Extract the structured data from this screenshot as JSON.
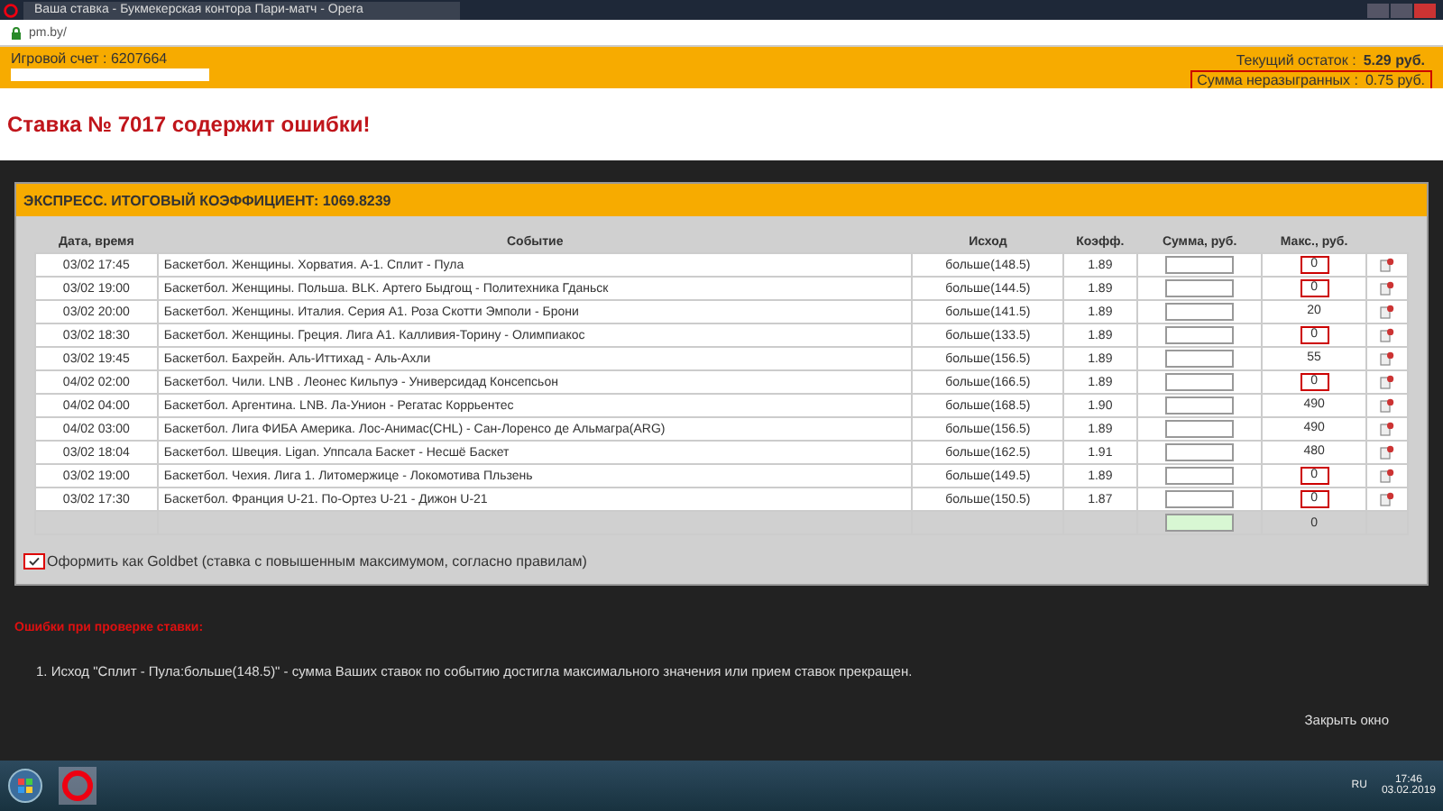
{
  "browser": {
    "tab_title": "Ваша ставка - Букмекерская контора Пари-матч - Opera",
    "address": "pm.by/"
  },
  "account": {
    "label": "Игровой счет :",
    "number": "6207664",
    "balance_label": "Текущий остаток :",
    "balance": "5.29 руб.",
    "unplayed_label": "Сумма неразыгранных :",
    "unplayed": "0.75 руб.",
    "unplayed_highlighted": true
  },
  "error_title": "Ставка № 7017 содержит ошибки!",
  "express": {
    "title": "ЭКСПРЕСС. ИТОГОВЫЙ КОЭФФИЦИЕНТ: 1069.8239",
    "columns": [
      "Дата, время",
      "Событие",
      "Исход",
      "Коэфф.",
      "Сумма, руб.",
      "Макс., руб."
    ],
    "rows": [
      {
        "date": "03/02 17:45",
        "event": "Баскетбол. Женщины. Хорватия. А-1. Сплит - Пула",
        "outcome": "больше(148.5)",
        "coef": "1.89",
        "max": "0",
        "highlighted": true
      },
      {
        "date": "03/02 19:00",
        "event": "Баскетбол. Женщины. Польша. BLK. Артего Быдгощ - Политехника Гданьск",
        "outcome": "больше(144.5)",
        "coef": "1.89",
        "max": "0",
        "highlighted": true
      },
      {
        "date": "03/02 20:00",
        "event": "Баскетбол. Женщины. Италия. Серия А1. Роза Скотти Эмполи - Брони",
        "outcome": "больше(141.5)",
        "coef": "1.89",
        "max": "20",
        "highlighted": false
      },
      {
        "date": "03/02 18:30",
        "event": "Баскетбол. Женщины. Греция. Лига А1. Калливия-Торину - Олимпиакос",
        "outcome": "больше(133.5)",
        "coef": "1.89",
        "max": "0",
        "highlighted": true
      },
      {
        "date": "03/02 19:45",
        "event": "Баскетбол. Бахрейн. Аль-Иттихад - Аль-Ахли",
        "outcome": "больше(156.5)",
        "coef": "1.89",
        "max": "55",
        "highlighted": false
      },
      {
        "date": "04/02 02:00",
        "event": "Баскетбол. Чили. LNB . Леонес Кильпуэ - Универсидад Консепсьон",
        "outcome": "больше(166.5)",
        "coef": "1.89",
        "max": "0",
        "highlighted": true
      },
      {
        "date": "04/02 04:00",
        "event": "Баскетбол. Аргентина. LNB. Ла-Унион - Регатас Коррьентес",
        "outcome": "больше(168.5)",
        "coef": "1.90",
        "max": "490",
        "highlighted": false
      },
      {
        "date": "04/02 03:00",
        "event": "Баскетбол. Лига ФИБА Америка. Лос-Анимас(CHL) - Сан-Лоренсо де Альмагра(ARG)",
        "outcome": "больше(156.5)",
        "coef": "1.89",
        "max": "490",
        "highlighted": false
      },
      {
        "date": "03/02 18:04",
        "event": "Баскетбол. Швеция. Ligan. Уппсала Баскет - Несшё Баскет",
        "outcome": "больше(162.5)",
        "coef": "1.91",
        "max": "480",
        "highlighted": false
      },
      {
        "date": "03/02 19:00",
        "event": "Баскетбол. Чехия. Лига 1. Литомержице - Локомотива Пльзень",
        "outcome": "больше(149.5)",
        "coef": "1.89",
        "max": "0",
        "highlighted": true
      },
      {
        "date": "03/02 17:30",
        "event": "Баскетбол. Франция U-21. По-Ортез U-21 - Дижон U-21",
        "outcome": "больше(150.5)",
        "coef": "1.87",
        "max": "0",
        "highlighted": true
      }
    ],
    "total_max": "0",
    "goldbet": {
      "label": "Оформить как Goldbet (ставка с повышенным максимумом, согласно правилам)",
      "checked": true,
      "highlighted": true
    }
  },
  "errors": {
    "title": "Ошибки при проверке ставки:",
    "items": [
      "1. Исход \"Сплит - Пула:больше(148.5)\" - сумма Ваших ставок по событию достигла максимального значения или прием ставок прекращен."
    ]
  },
  "close_link": "Закрыть окно",
  "taskbar": {
    "language": "RU",
    "time": "17:46",
    "date": "03.02.2019"
  }
}
